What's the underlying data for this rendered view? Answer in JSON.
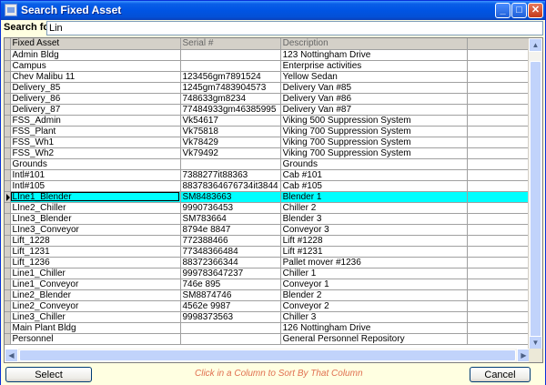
{
  "window": {
    "title": "Search Fixed Asset"
  },
  "search": {
    "label": "Search for",
    "value": "Lin"
  },
  "table": {
    "columns": [
      "Fixed Asset",
      "Serial #",
      "Description"
    ],
    "selected_row": 13,
    "rows": [
      [
        "Admin Bldg",
        "",
        "123 Nottingham Drive"
      ],
      [
        "Campus",
        "",
        "Enterprise activities"
      ],
      [
        "Chev Malibu 11",
        "123456gm7891524",
        "Yellow Sedan"
      ],
      [
        "Delivery_85",
        "1245gm7483904573",
        "Delivery Van #85"
      ],
      [
        "Delivery_86",
        "748633gm8234",
        "Delivery Van #86"
      ],
      [
        "Delivery_87",
        "77484933gm46385995",
        "Delivery Van #87"
      ],
      [
        "FSS_Admin",
        "Vk54617",
        "Viking 500 Suppression System"
      ],
      [
        "FSS_Plant",
        "Vk75818",
        "Viking 700 Suppression System"
      ],
      [
        "FSS_Wh1",
        "Vk78429",
        "Viking 700 Suppression System"
      ],
      [
        "FSS_Wh2",
        "Vk79492",
        "Viking 700 Suppression System"
      ],
      [
        "Grounds",
        "",
        "Grounds"
      ],
      [
        "Intl#101",
        "7388277it88363",
        "Cab #101"
      ],
      [
        "Intl#105",
        "88378364676734it3844",
        "Cab #105"
      ],
      [
        "LIne1_Blender",
        "SM8483663",
        "Blender 1"
      ],
      [
        "LIne2_Chiller",
        "9990736453",
        "Chiller 2"
      ],
      [
        "LIne3_Blender",
        "SM783664",
        "Blender 3"
      ],
      [
        "LIne3_Conveyor",
        "8794e  8847",
        "Conveyor 3"
      ],
      [
        "Lift_1228",
        "772388466",
        "Lift #1228"
      ],
      [
        "Lift_1231",
        "77348366484",
        "Lift #1231"
      ],
      [
        "Lift_1236",
        "88372366344",
        "Pallet mover #1236"
      ],
      [
        "Line1_Chiller",
        "999783647237",
        "Chiller 1"
      ],
      [
        "Line1_Conveyor",
        "746e 895",
        "Conveyor 1"
      ],
      [
        "Line2_Blender",
        "SM8874746",
        "Blender 2"
      ],
      [
        "Line2_Conveyor",
        "4562e 9987",
        "Conveyor 2"
      ],
      [
        "Line3_Chiller",
        "9998373563",
        "Chiller 3"
      ],
      [
        "Main Plant Bldg",
        "",
        "126 Nottingham Drive"
      ],
      [
        "Personnel",
        "",
        "General Personnel Repository"
      ]
    ]
  },
  "footer": {
    "select_label": "Select",
    "hint": "Click in a Column to Sort By That Column",
    "cancel_label": "Cancel"
  }
}
